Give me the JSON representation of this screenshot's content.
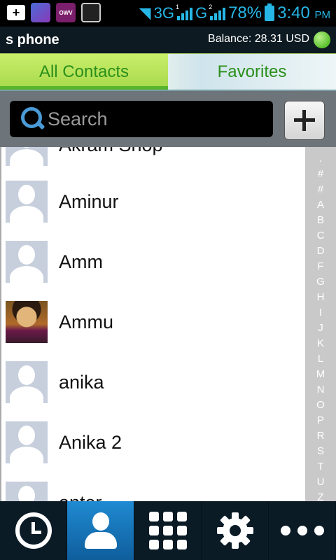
{
  "status_bar": {
    "notifications": [
      {
        "name": "add-notification-icon",
        "label": "+"
      },
      {
        "name": "app-notification-icon",
        "label": ""
      },
      {
        "name": "owv-notification-icon",
        "label": "OWV"
      },
      {
        "name": "image-notification-icon",
        "label": ""
      }
    ],
    "network_3g": "3G",
    "network_g": "G",
    "sim1": "1",
    "sim2": "2",
    "battery": "78%",
    "time": "3:40",
    "ampm": "PM",
    "accent_color": "#27b7e6"
  },
  "header": {
    "title": "s phone",
    "balance": "Balance: 28.31 USD",
    "status_color": "#5bc12e"
  },
  "tabs": [
    {
      "label": "All Contacts",
      "active": true
    },
    {
      "label": "Favorites",
      "active": false
    }
  ],
  "search": {
    "placeholder": "Search",
    "value": ""
  },
  "contacts": [
    {
      "name": "Akram Shop",
      "avatar": "default"
    },
    {
      "name": "Aminur",
      "avatar": "default"
    },
    {
      "name": "Amm",
      "avatar": "default"
    },
    {
      "name": "Ammu",
      "avatar": "photo"
    },
    {
      "name": "anika",
      "avatar": "default"
    },
    {
      "name": "Anika 2",
      "avatar": "default"
    },
    {
      "name": "anter",
      "avatar": "default"
    }
  ],
  "alphabet_index": [
    ".",
    "#",
    "#",
    "A",
    "B",
    "C",
    "D",
    "F",
    "G",
    "H",
    "I",
    "J",
    "K",
    "L",
    "M",
    "N",
    "O",
    "P",
    "R",
    "S",
    "T",
    "U",
    "Z"
  ],
  "bottom_nav": [
    {
      "icon": "clock-icon",
      "label": "Recent calls",
      "active": false
    },
    {
      "icon": "person-icon",
      "label": "Contacts",
      "active": true
    },
    {
      "icon": "dialpad-icon",
      "label": "Dialpad",
      "active": false
    },
    {
      "icon": "gear-icon",
      "label": "Settings",
      "active": false
    },
    {
      "icon": "more-icon",
      "label": "More",
      "active": false
    }
  ]
}
